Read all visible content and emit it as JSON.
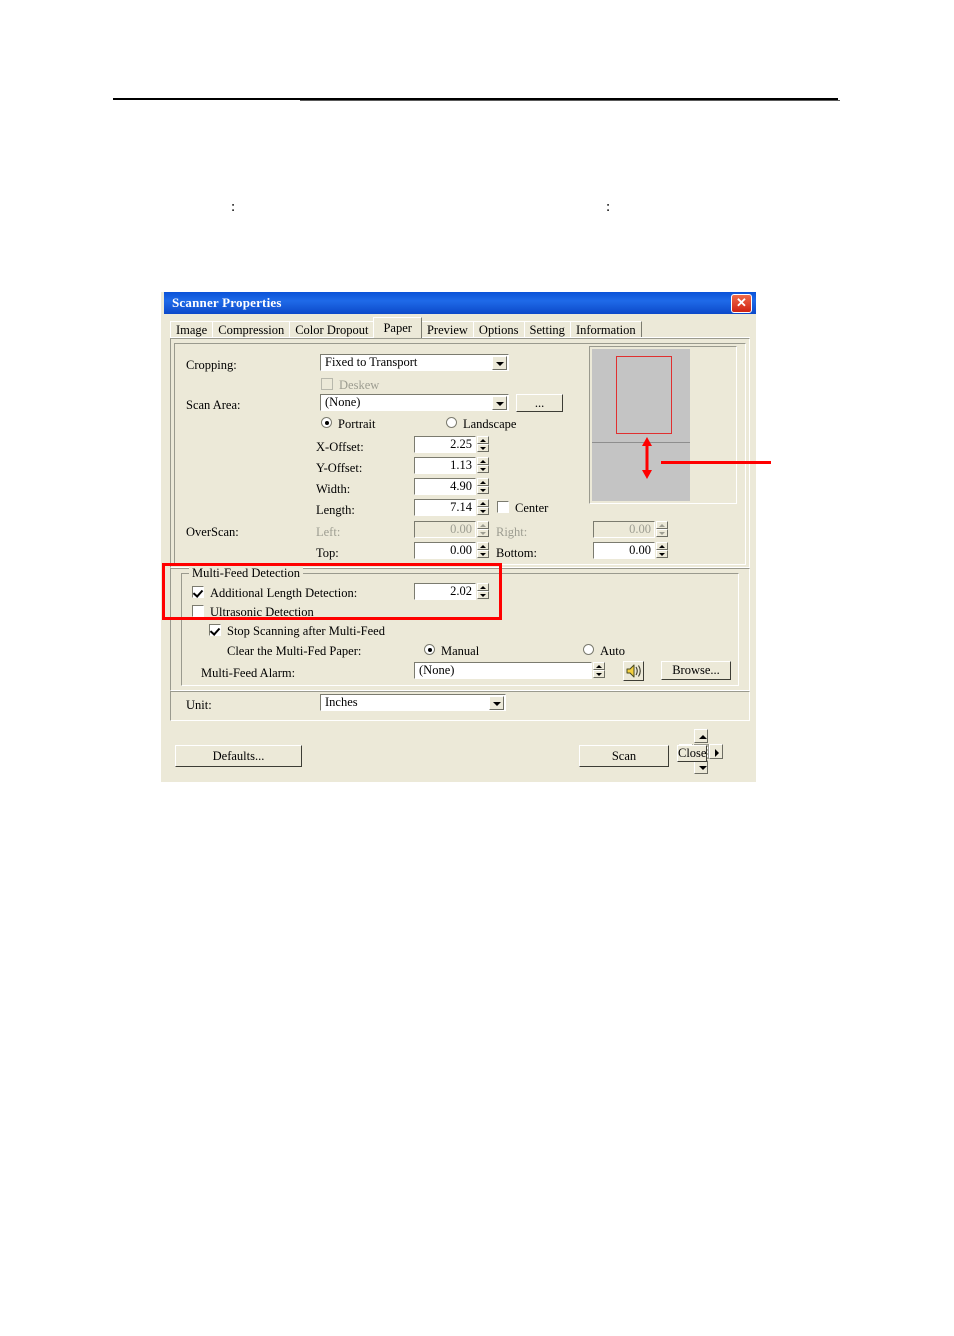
{
  "page": {
    "stray_colons": [
      ":",
      ":"
    ]
  },
  "dialog": {
    "title": "Scanner Properties",
    "close_label": "✕",
    "tabs": [
      {
        "label": "Image",
        "active": false
      },
      {
        "label": "Compression",
        "active": false
      },
      {
        "label": "Color Dropout",
        "active": false
      },
      {
        "label": "Paper",
        "active": true
      },
      {
        "label": "Preview",
        "active": false
      },
      {
        "label": "Options",
        "active": false
      },
      {
        "label": "Setting",
        "active": false
      },
      {
        "label": "Information",
        "active": false
      }
    ],
    "paper_tab": {
      "cropping": {
        "label": "Cropping:",
        "value": "Fixed to Transport"
      },
      "deskew": {
        "label": "Deskew",
        "checked": false,
        "enabled": false
      },
      "scan_area": {
        "label": "Scan Area:",
        "value": "(None)",
        "browse_label": "..."
      },
      "orientation": {
        "portrait_label": "Portrait",
        "landscape_label": "Landscape",
        "selected": "Portrait"
      },
      "fields": [
        {
          "label": "X-Offset:",
          "value": "2.25",
          "enabled": true
        },
        {
          "label": "Y-Offset:",
          "value": "1.13",
          "enabled": true
        },
        {
          "label": "Width:",
          "value": "4.90",
          "enabled": true
        },
        {
          "label": "Length:",
          "value": "7.14",
          "enabled": true
        }
      ],
      "center": {
        "label": "Center",
        "checked": false
      },
      "overscan": {
        "label": "OverScan:",
        "left": {
          "label": "Left:",
          "value": "0.00",
          "enabled": false
        },
        "right": {
          "label": "Right:",
          "value": "0.00",
          "enabled": false
        },
        "top": {
          "label": "Top:",
          "value": "0.00",
          "enabled": true
        },
        "bottom": {
          "label": "Bottom:",
          "value": "0.00",
          "enabled": true
        }
      },
      "multi_feed": {
        "group_label": "Multi-Feed Detection",
        "additional_length": {
          "label": "Additional Length Detection:",
          "checked": true,
          "value": "2.02"
        },
        "ultrasonic": {
          "label": "Ultrasonic Detection",
          "checked": false
        },
        "stop_scanning": {
          "label": "Stop Scanning after Multi-Feed",
          "checked": true
        },
        "clear_paper": {
          "label": "Clear the Multi-Fed Paper:",
          "manual_label": "Manual",
          "auto_label": "Auto",
          "selected": "Manual"
        },
        "alarm": {
          "label": "Multi-Feed Alarm:",
          "value": "(None)",
          "browse_label": "Browse...",
          "speaker_icon": "speaker-icon"
        }
      },
      "unit": {
        "label": "Unit:",
        "value": "Inches"
      }
    },
    "buttons": {
      "defaults": "Defaults...",
      "scan": "Scan",
      "close": "Close"
    }
  },
  "annotations": {
    "highlight_color": "#ff0000",
    "preview_rect_color": "#e03030",
    "callout_arrow": "double-headed-vertical-arrow",
    "callout_line": "horizontal-pointer-line"
  },
  "colors": {
    "dialog_face": "#ece9d8",
    "titlebar_blue": "#0a52d8",
    "preview_gray": "#c4c4c4",
    "disabled_text": "#9d9d91"
  }
}
